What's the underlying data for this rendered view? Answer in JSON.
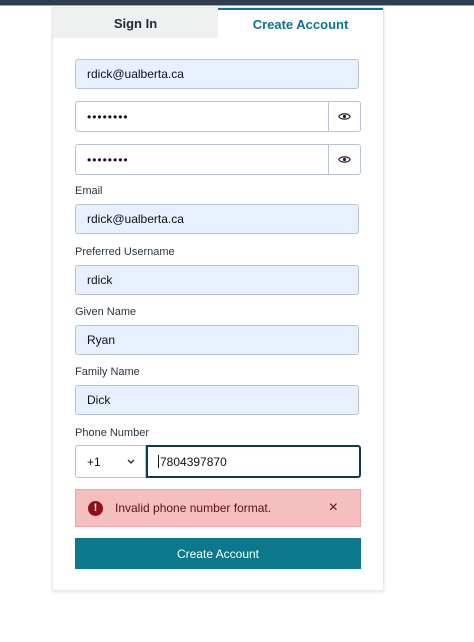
{
  "tabs": [
    {
      "label": "Sign In",
      "active": false
    },
    {
      "label": "Create Account",
      "active": true
    }
  ],
  "form": {
    "username_field_value": "rdick@ualberta.ca",
    "password_mask": "••••••••",
    "confirm_password_mask": "••••••••",
    "email": {
      "label": "Email",
      "value": "rdick@ualberta.ca"
    },
    "preferred_username": {
      "label": "Preferred Username",
      "value": "rdick"
    },
    "given_name": {
      "label": "Given Name",
      "value": "Ryan"
    },
    "family_name": {
      "label": "Family Name",
      "value": "Dick"
    },
    "phone": {
      "label": "Phone Number",
      "country_code": "+1",
      "value": "7804397870"
    }
  },
  "alert": {
    "message": "Invalid phone number format.",
    "close_symbol": "×",
    "icon": "error-icon",
    "color": "#8f1016"
  },
  "submit_label": "Create Account",
  "colors": {
    "accent": "#0c788c",
    "autofill": "#e8f0fe",
    "alert_bg": "#f5bfc0"
  }
}
